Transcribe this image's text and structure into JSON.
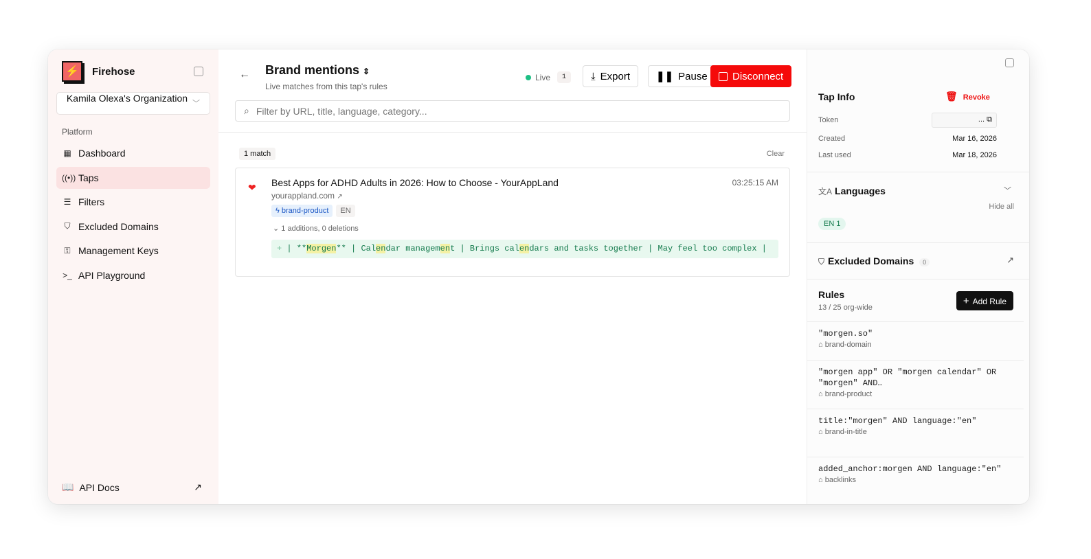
{
  "sidebar": {
    "app_name": "Firehose",
    "org": "Kamila Olexa's Organization",
    "section": "Platform",
    "items": [
      {
        "label": "Dashboard",
        "icon": "grid-icon"
      },
      {
        "label": "Taps",
        "icon": "broadcast-icon",
        "active": true
      },
      {
        "label": "Filters",
        "icon": "filter-icon"
      },
      {
        "label": "Excluded Domains",
        "icon": "shield-icon"
      },
      {
        "label": "Management Keys",
        "icon": "key-icon"
      },
      {
        "label": "API Playground",
        "icon": "terminal-icon"
      }
    ],
    "docs": "API Docs"
  },
  "header": {
    "title": "Brand mentions",
    "subtitle": "Live matches from this tap's rules",
    "status": "Live",
    "count": "1",
    "export": "Export",
    "pause": "Pause",
    "disconnect": "Disconnect",
    "search_placeholder": "Filter by URL, title, language, category..."
  },
  "matches": {
    "count_label": "1 match",
    "clear": "Clear",
    "items": [
      {
        "title": "Best Apps for ADHD Adults in 2026: How to Choose - YourAppLand",
        "domain": "yourappland.com",
        "time": "03:25:15 AM",
        "rule_tag": "brand-product",
        "lang": "EN",
        "changes": "1 additions, 0 deletions",
        "diff": [
          {
            "t": "| **",
            "h": false
          },
          {
            "t": "Morgen",
            "h": true
          },
          {
            "t": "** | Cal",
            "h": false
          },
          {
            "t": "en",
            "h": true
          },
          {
            "t": "dar managem",
            "h": false
          },
          {
            "t": "en",
            "h": true
          },
          {
            "t": "t | Brings cal",
            "h": false
          },
          {
            "t": "en",
            "h": true
          },
          {
            "t": "dars and tasks together | May feel too complex |",
            "h": false
          }
        ]
      }
    ]
  },
  "tap_info": {
    "title": "Tap Info",
    "revoke": "Revoke",
    "token_label": "Token",
    "token": "...",
    "created_label": "Created",
    "created": "Mar 16, 2026",
    "last_used_label": "Last used",
    "last_used": "Mar 18, 2026"
  },
  "languages": {
    "title": "Languages",
    "hide_all": "Hide all",
    "chip": "EN 1"
  },
  "excluded": {
    "title": "Excluded Domains",
    "count": "0"
  },
  "rules": {
    "title": "Rules",
    "subtitle": "13 / 25 org-wide",
    "add": "Add Rule",
    "items": [
      {
        "query": "\"morgen.so\"",
        "tag": "brand-domain"
      },
      {
        "query": "\"morgen app\" OR \"morgen calendar\" OR \"morgen\" AND…",
        "tag": "brand-product"
      },
      {
        "query": "title:\"morgen\" AND language:\"en\"",
        "tag": "brand-in-title"
      },
      {
        "query": "added_anchor:morgen AND language:\"en\"",
        "tag": "backlinks"
      }
    ]
  },
  "colors": {
    "accent": "#f50a0a",
    "live": "#1dbf84",
    "active_nav": "#fbe2e2"
  }
}
